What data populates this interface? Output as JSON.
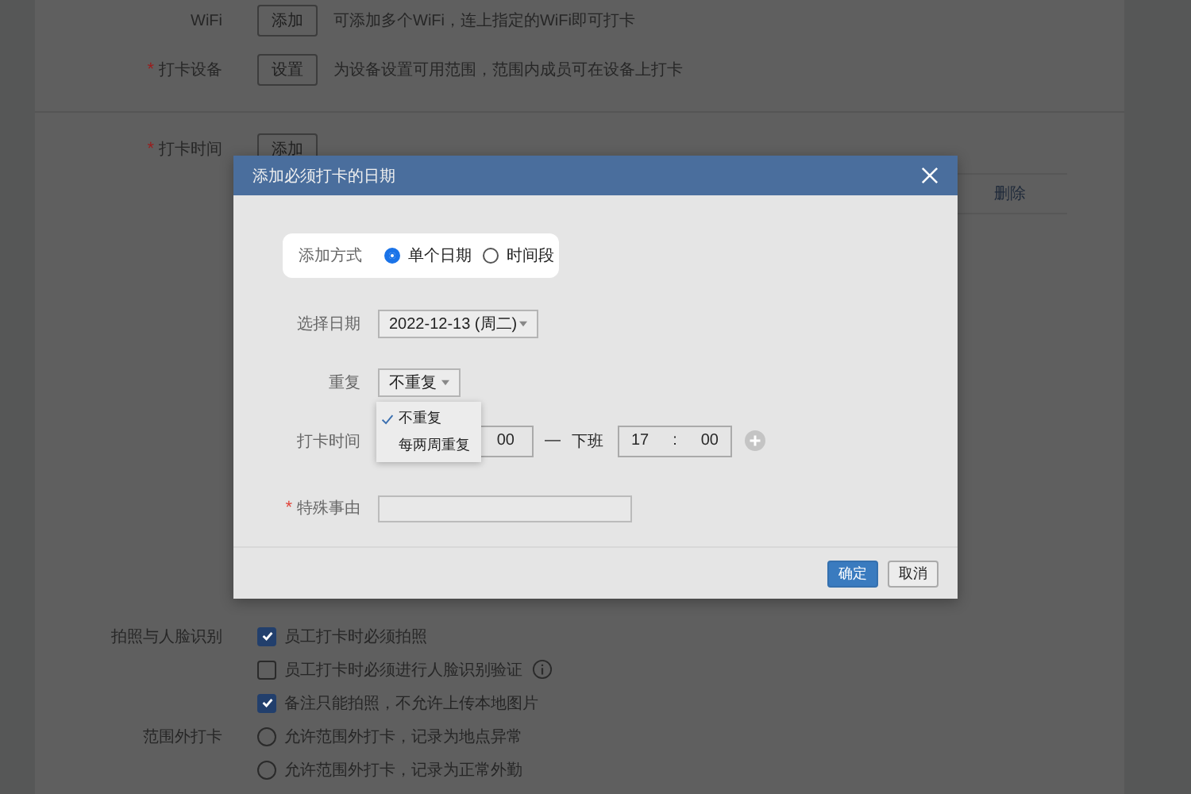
{
  "page": {
    "rows_top": [
      {
        "label": "WiFi",
        "button": "添加",
        "hint": "可添加多个WiFi，连上指定的WiFi即可打卡"
      },
      {
        "label": "打卡设备",
        "marker": "*",
        "button": "设置",
        "hint": "为设备设置可用范围，范围内成员可在设备上打卡"
      },
      {
        "label": "打卡时间",
        "marker": "*",
        "button": "添加"
      }
    ],
    "time_list_action": "删除",
    "photo": {
      "label": "拍照与人脸识别",
      "options": [
        {
          "label": "员工打卡时必须拍照",
          "checked": true,
          "info": false
        },
        {
          "label": "员工打卡时必须进行人脸识别验证",
          "checked": false,
          "info": true
        },
        {
          "label": "备注只能拍照，不允许上传本地图片",
          "checked": true,
          "info": false
        }
      ]
    },
    "out_of_range": {
      "label": "范围外打卡",
      "options": [
        {
          "label": "允许范围外打卡，记录为地点异常",
          "selected": false
        },
        {
          "label": "允许范围外打卡，记录为正常外勤",
          "selected": false
        }
      ]
    }
  },
  "dialog": {
    "title": "添加必须打卡的日期",
    "mode": {
      "label": "添加方式",
      "options": [
        {
          "label": "单个日期",
          "selected": true
        },
        {
          "label": "时间段",
          "selected": false
        }
      ]
    },
    "date": {
      "label": "选择日期",
      "value": "2022-12-13 (周二)"
    },
    "repeat": {
      "label": "重复",
      "value": "不重复",
      "menu": [
        {
          "label": "不重复",
          "selected": true
        },
        {
          "label": "每两周重复",
          "selected": false
        }
      ]
    },
    "time": {
      "label": "打卡时间",
      "start_minute": "00",
      "separator": "—",
      "end_label": "下班",
      "end_hour": "17",
      "colon": ":",
      "end_minute": "00"
    },
    "reason": {
      "label": "特殊事由",
      "marker": "*"
    },
    "buttons": [
      {
        "label": "确定",
        "kind": "primary"
      },
      {
        "label": "取消",
        "kind": "default"
      }
    ]
  }
}
